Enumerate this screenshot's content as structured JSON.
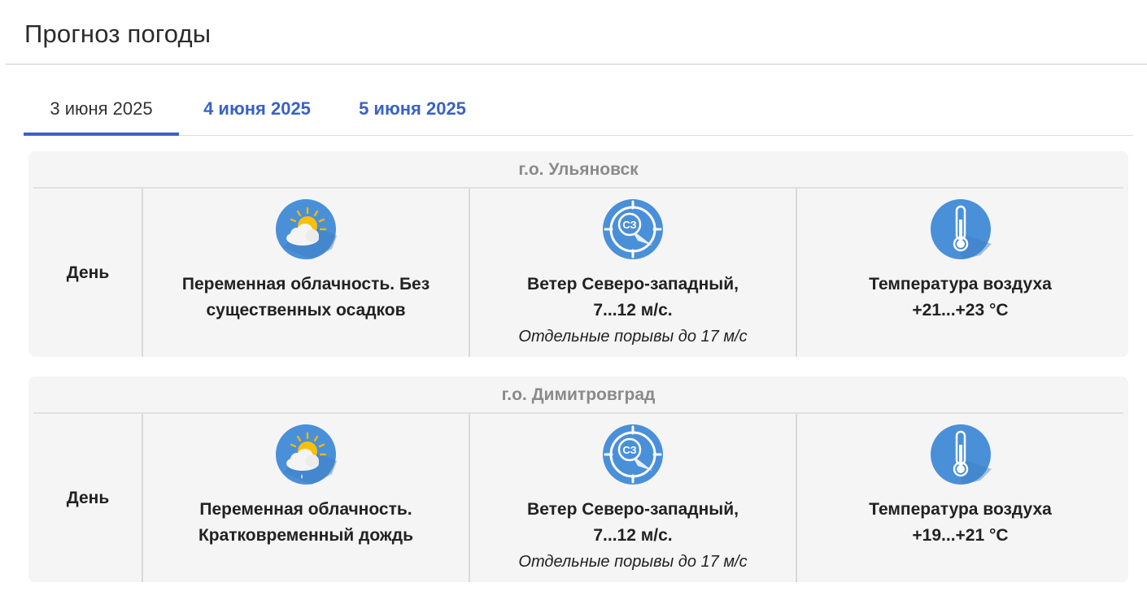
{
  "page": {
    "title": "Прогноз погоды"
  },
  "tabs": [
    {
      "label": "3 июня 2025",
      "active": true
    },
    {
      "label": "4 июня 2025",
      "active": false
    },
    {
      "label": "5 июня 2025",
      "active": false
    }
  ],
  "icons": {
    "weather": "partly-cloudy-icon",
    "wind": "wind-compass-icon",
    "temperature": "thermometer-icon"
  },
  "colors": {
    "accent": "#3a62c4",
    "icon_blue": "#4a90d9",
    "card_bg": "#f5f5f6"
  },
  "forecasts": [
    {
      "city": "г.о. Ульяновск",
      "period": "День",
      "weather": {
        "line1": "Переменная облачность. Без",
        "line2": "существенных осадков"
      },
      "wind": {
        "direction_code": "СЗ",
        "line1": "Ветер Северо-западный,",
        "line2": "7...12 м/с.",
        "note": "Отдельные порывы до 17 м/с"
      },
      "temperature": {
        "line1": "Температура воздуха",
        "line2": "+21...+23 °С"
      }
    },
    {
      "city": "г.о. Димитровград",
      "period": "День",
      "weather": {
        "line1": "Переменная облачность.",
        "line2": "Кратковременный дождь"
      },
      "wind": {
        "direction_code": "СЗ",
        "line1": "Ветер Северо-западный,",
        "line2": "7...12 м/с.",
        "note": "Отдельные порывы до 17 м/с"
      },
      "temperature": {
        "line1": "Температура воздуха",
        "line2": "+19...+21 °С"
      }
    }
  ]
}
